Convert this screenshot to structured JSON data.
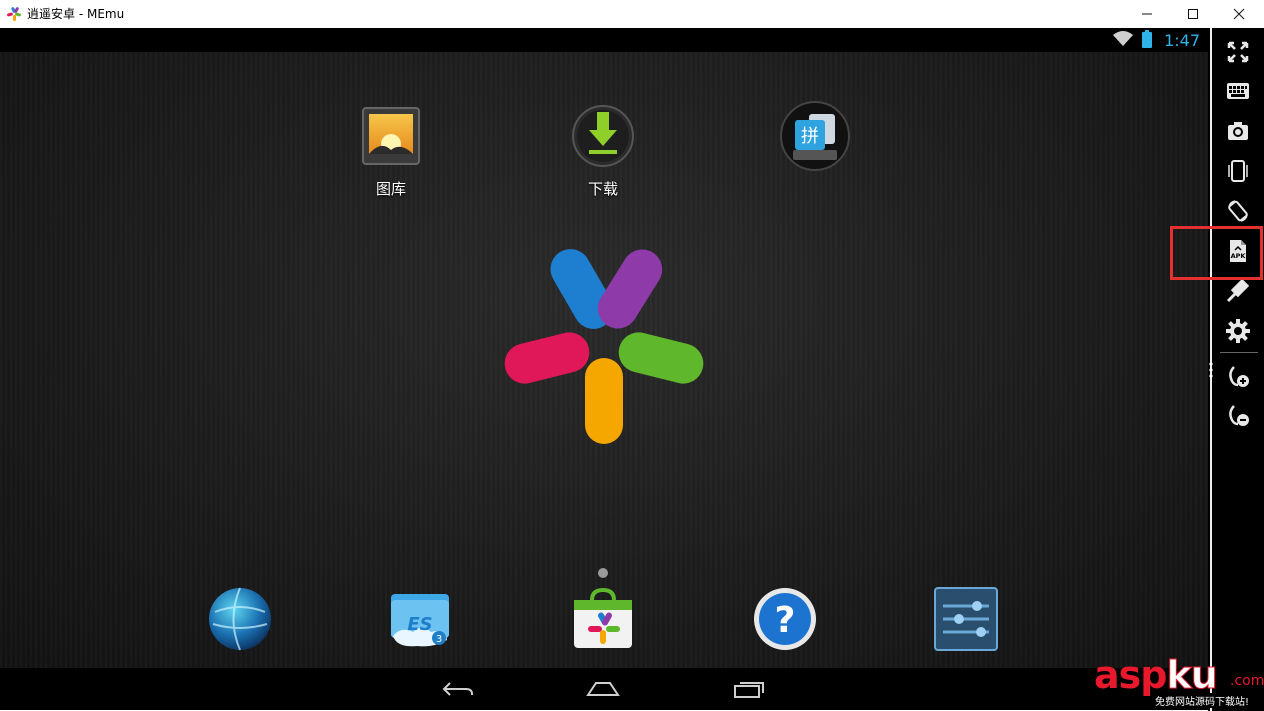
{
  "window": {
    "title": "逍遥安卓 - MEmu",
    "buttons": [
      "minimize",
      "maximize",
      "close"
    ]
  },
  "status_bar": {
    "time": "1:47",
    "icons": [
      "wifi-icon",
      "battery-icon"
    ],
    "accent_color": "#2fb4e8"
  },
  "home": {
    "apps": [
      {
        "label": "图库",
        "icon": "gallery-icon"
      },
      {
        "label": "下载",
        "icon": "download-icon"
      },
      {
        "label": "",
        "icon": "pinyin-input-icon"
      }
    ],
    "center_logo": "memu-logo",
    "page_indicator": {
      "count": 1,
      "active": 1
    }
  },
  "dock": [
    {
      "icon": "browser-globe-icon"
    },
    {
      "icon": "es-file-explorer-icon"
    },
    {
      "icon": "app-store-icon"
    },
    {
      "icon": "help-icon"
    },
    {
      "icon": "settings-sliders-icon"
    }
  ],
  "nav_bar": [
    "back-icon",
    "home-icon",
    "recents-icon"
  ],
  "toolbar": {
    "items": [
      "fullscreen-icon",
      "keyboard-icon",
      "screenshot-camera-icon",
      "shake-phone-icon",
      "rotate-icon",
      "install-apk-icon",
      "location-pin-icon",
      "settings-gear-icon",
      "volume-up-icon",
      "volume-down-icon"
    ],
    "highlighted": "install-apk-icon",
    "highlight_color": "#e53030",
    "apk_text": "APK"
  },
  "watermark": {
    "brand_a": "asp",
    "brand_b": "ku",
    "suffix": ".com",
    "tagline": "免费网站源码下载站!"
  }
}
